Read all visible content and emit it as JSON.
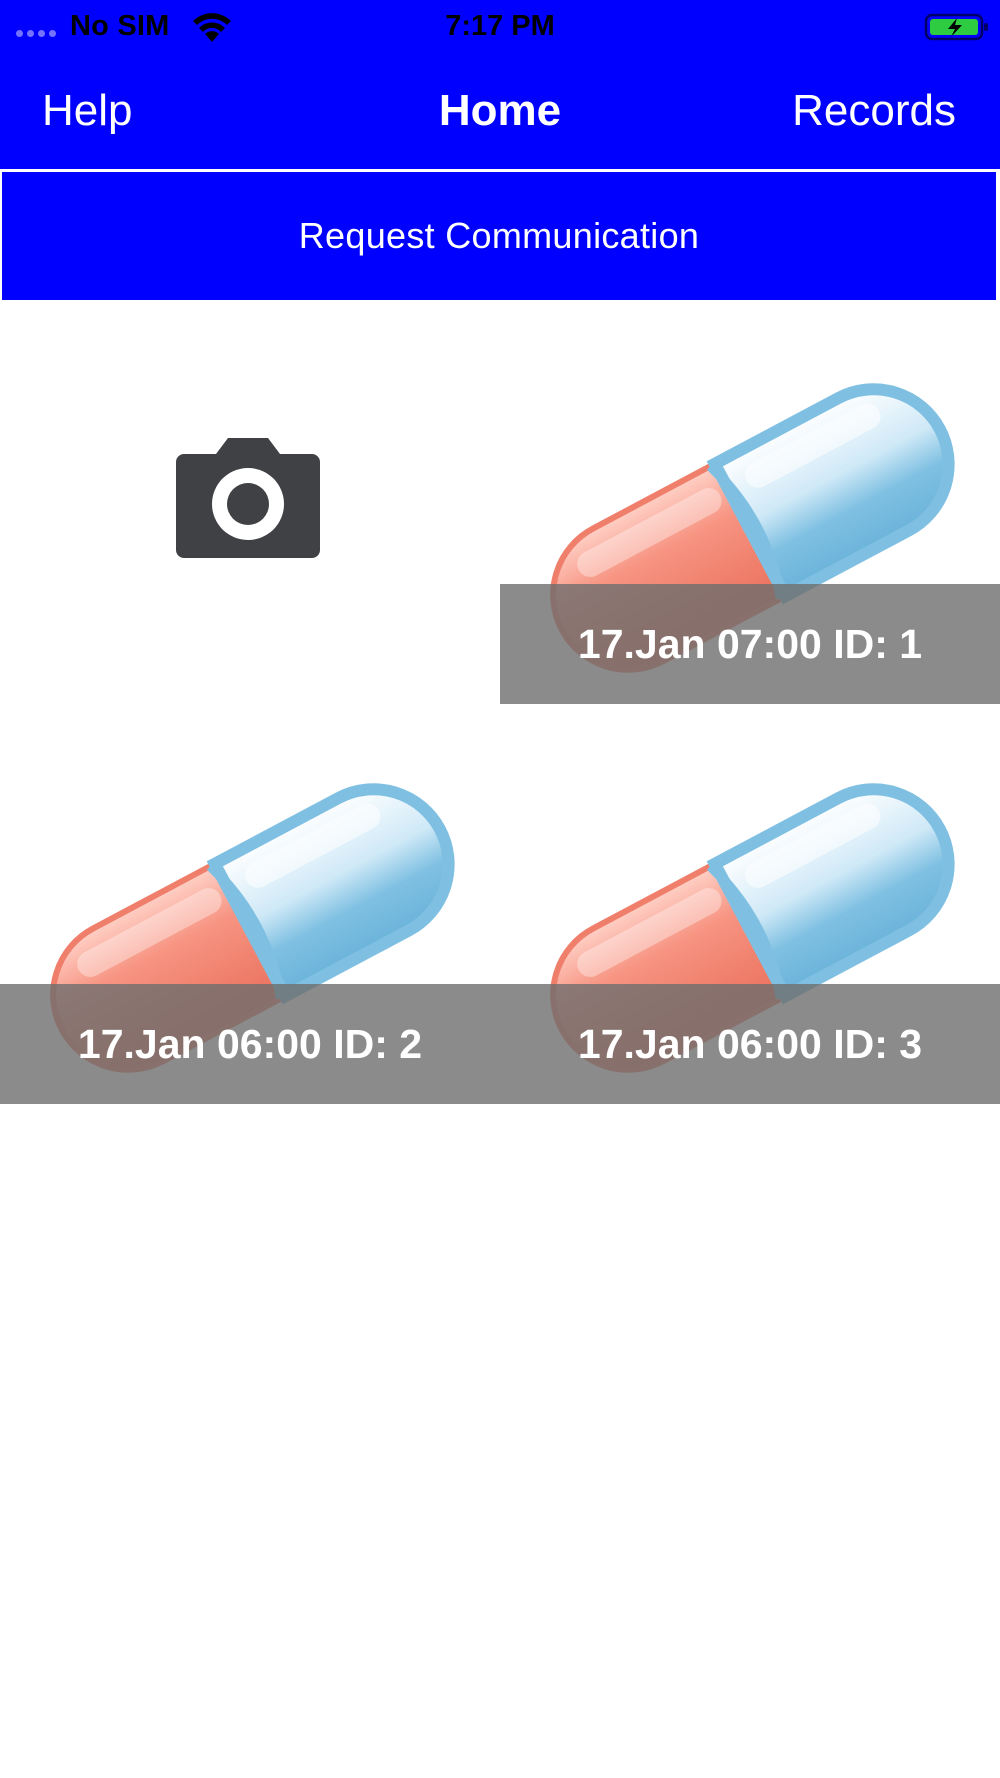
{
  "status_bar": {
    "carrier": "No SIM",
    "time": "7:17 PM"
  },
  "nav": {
    "left": "Help",
    "title": "Home",
    "right": "Records"
  },
  "request_button": "Request Communication",
  "colors": {
    "accent": "#0000ff",
    "caption_overlay": "#6e6e6e",
    "camera_icon": "#3f4144",
    "pill_red": "#f79482",
    "pill_blue": "#7fc0e2"
  },
  "camera": {
    "icon": "camera-icon"
  },
  "medications": [
    {
      "icon": "capsule-icon",
      "caption": "17.Jan 07:00 ID: 1"
    },
    {
      "icon": "capsule-icon",
      "caption": "17.Jan 06:00 ID: 2"
    },
    {
      "icon": "capsule-icon",
      "caption": "17.Jan 06:00 ID: 3"
    }
  ]
}
